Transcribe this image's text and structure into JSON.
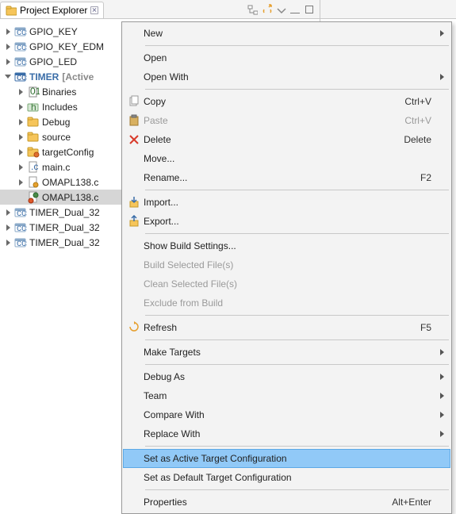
{
  "tab": {
    "title": "Project Explorer"
  },
  "tree": {
    "items": [
      {
        "label": "GPIO_KEY",
        "depth": 0,
        "exp": "collapsed",
        "icon": "proj"
      },
      {
        "label": "GPIO_KEY_EDM",
        "depth": 0,
        "exp": "collapsed",
        "icon": "proj"
      },
      {
        "label": "GPIO_LED",
        "depth": 0,
        "exp": "collapsed",
        "icon": "proj"
      },
      {
        "label": "TIMER",
        "suffix": "[Active",
        "depth": 0,
        "exp": "expanded",
        "icon": "proj-active",
        "active": true
      },
      {
        "label": "Binaries",
        "depth": 1,
        "exp": "collapsed",
        "icon": "bin"
      },
      {
        "label": "Includes",
        "depth": 1,
        "exp": "collapsed",
        "icon": "inc"
      },
      {
        "label": "Debug",
        "depth": 1,
        "exp": "collapsed",
        "icon": "folder"
      },
      {
        "label": "source",
        "depth": 1,
        "exp": "collapsed",
        "icon": "folder"
      },
      {
        "label": "targetConfig",
        "depth": 1,
        "exp": "collapsed",
        "icon": "folder-t"
      },
      {
        "label": "main.c",
        "depth": 1,
        "exp": "collapsed",
        "icon": "cfile"
      },
      {
        "label": "OMAPL138.c",
        "depth": 1,
        "exp": "collapsed",
        "icon": "gfile"
      },
      {
        "label": "OMAPL138.c",
        "depth": 1,
        "exp": "none",
        "icon": "target",
        "selected": true
      },
      {
        "label": "TIMER_Dual_32",
        "depth": 0,
        "exp": "collapsed",
        "icon": "proj"
      },
      {
        "label": "TIMER_Dual_32",
        "depth": 0,
        "exp": "collapsed",
        "icon": "proj"
      },
      {
        "label": "TIMER_Dual_32",
        "depth": 0,
        "exp": "collapsed",
        "icon": "proj"
      }
    ]
  },
  "menu": {
    "groups": [
      [
        {
          "label": "New",
          "icon": "",
          "sub": true
        }
      ],
      [
        {
          "label": "Open"
        },
        {
          "label": "Open With",
          "sub": true
        }
      ],
      [
        {
          "label": "Copy",
          "icon": "copy",
          "shortcut": "Ctrl+V"
        },
        {
          "label": "Paste",
          "icon": "paste",
          "shortcut": "Ctrl+V",
          "disabled": true
        },
        {
          "label": "Delete",
          "icon": "delete",
          "shortcut": "Delete"
        },
        {
          "label": "Move..."
        },
        {
          "label": "Rename...",
          "shortcut": "F2"
        }
      ],
      [
        {
          "label": "Import...",
          "icon": "import"
        },
        {
          "label": "Export...",
          "icon": "export"
        }
      ],
      [
        {
          "label": "Show Build Settings..."
        },
        {
          "label": "Build Selected File(s)",
          "disabled": true
        },
        {
          "label": "Clean Selected File(s)",
          "disabled": true
        },
        {
          "label": "Exclude from Build",
          "disabled": true
        }
      ],
      [
        {
          "label": "Refresh",
          "icon": "refresh",
          "shortcut": "F5"
        }
      ],
      [
        {
          "label": "Make Targets",
          "sub": true
        }
      ],
      [
        {
          "label": "Debug As",
          "sub": true
        },
        {
          "label": "Team",
          "sub": true
        },
        {
          "label": "Compare With",
          "sub": true
        },
        {
          "label": "Replace With",
          "sub": true
        }
      ],
      [
        {
          "label": "Set as Active Target Configuration",
          "highlight": true
        },
        {
          "label": "Set as Default Target Configuration"
        }
      ],
      [
        {
          "label": "Properties",
          "shortcut": "Alt+Enter"
        }
      ]
    ]
  }
}
